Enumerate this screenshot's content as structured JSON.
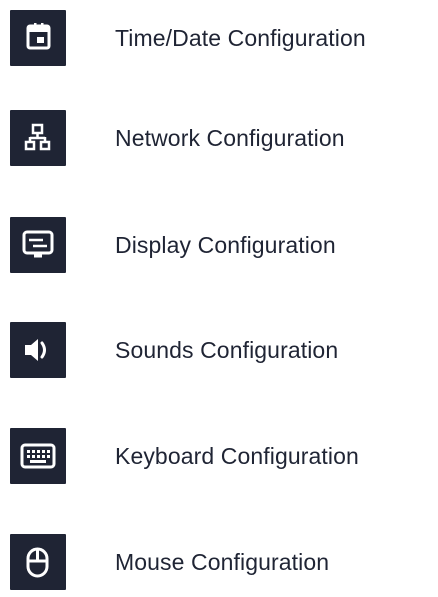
{
  "colors": {
    "icon_background": "#1f2434",
    "icon_foreground": "#ffffff",
    "label_text": "#1f2434",
    "page_background": "#ffffff"
  },
  "menu": {
    "items": [
      {
        "label": "Time/Date Configuration",
        "icon": "calendar-icon"
      },
      {
        "label": "Network Configuration",
        "icon": "network-icon"
      },
      {
        "label": "Display Configuration",
        "icon": "display-icon"
      },
      {
        "label": "Sounds Configuration",
        "icon": "speaker-icon"
      },
      {
        "label": "Keyboard Configuration",
        "icon": "keyboard-icon"
      },
      {
        "label": "Mouse Configuration",
        "icon": "mouse-icon"
      }
    ]
  }
}
